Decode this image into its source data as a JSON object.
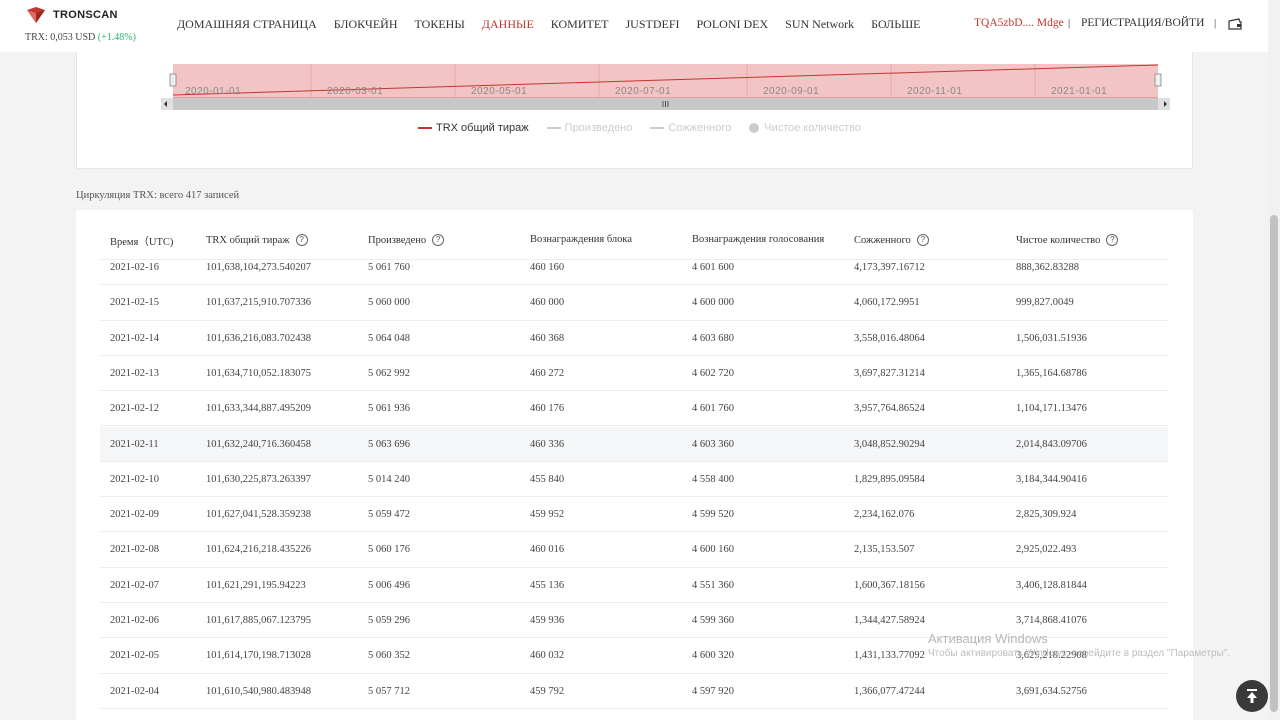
{
  "header": {
    "brand": "TRONSCAN",
    "price_label": "TRX: 0,053 USD",
    "price_change": "(+1.48%)",
    "nav": [
      {
        "label": "ДОМАШНЯЯ СТРАНИЦА",
        "active": false
      },
      {
        "label": "БЛОКЧЕЙН",
        "active": false
      },
      {
        "label": "ТОКЕНЫ",
        "active": false
      },
      {
        "label": "ДАННЫЕ",
        "active": true
      },
      {
        "label": "КОМИТЕТ",
        "active": false
      },
      {
        "label": "JUSTDEFI",
        "active": false
      },
      {
        "label": "POLONI DEX",
        "active": false
      },
      {
        "label": "SUN Network",
        "active": false
      },
      {
        "label": "БОЛЬШЕ",
        "active": false
      }
    ],
    "account": "TQA5zbD.... Mdge",
    "separator": "|",
    "login": "РЕГИСТРАЦИЯ/ВОЙТИ"
  },
  "zoom": {
    "dates": [
      "2020-01-01",
      "2020-03-01",
      "2020-05-01",
      "2020-07-01",
      "2020-09-01",
      "2020-11-01",
      "2021-01-01"
    ]
  },
  "legend": [
    {
      "label": "TRX общий тираж",
      "color": "#c23631",
      "marker": "line",
      "active": true
    },
    {
      "label": "Произведено",
      "color": "#cccccc",
      "marker": "line",
      "active": false
    },
    {
      "label": "Сожженного",
      "color": "#cccccc",
      "marker": "line",
      "active": false
    },
    {
      "label": "Чистое количество",
      "color": "#cccccc",
      "marker": "dot",
      "active": false
    }
  ],
  "table": {
    "caption": "Циркуляция TRX: всего 417 записей",
    "headers": [
      {
        "label": "Время（UTC)",
        "help": false
      },
      {
        "label": "TRX общий тираж",
        "help": true
      },
      {
        "label": "Произведено",
        "help": true
      },
      {
        "label": "Вознаграждения блока",
        "help": false
      },
      {
        "label": "Вознаграждения голосования",
        "help": false
      },
      {
        "label": "Сожженного",
        "help": true
      },
      {
        "label": "Чистое количество",
        "help": true
      }
    ],
    "rows": [
      [
        "2021-02-16",
        "101,638,104,273.540207",
        "5 061 760",
        "460 160",
        "4 601 600",
        "4,173,397.16712",
        "888,362.83288"
      ],
      [
        "2021-02-15",
        "101,637,215,910.707336",
        "5 060 000",
        "460 000",
        "4 600 000",
        "4,060,172.9951",
        "999,827.0049"
      ],
      [
        "2021-02-14",
        "101,636,216,083.702438",
        "5 064 048",
        "460 368",
        "4 603 680",
        "3,558,016.48064",
        "1,506,031.51936"
      ],
      [
        "2021-02-13",
        "101,634,710,052.183075",
        "5 062 992",
        "460 272",
        "4 602 720",
        "3,697,827.31214",
        "1,365,164.68786"
      ],
      [
        "2021-02-12",
        "101,633,344,887.495209",
        "5 061 936",
        "460 176",
        "4 601 760",
        "3,957,764.86524",
        "1,104,171.13476"
      ],
      [
        "2021-02-11",
        "101,632,240,716.360458",
        "5 063 696",
        "460 336",
        "4 603 360",
        "3,048,852.90294",
        "2,014,843.09706"
      ],
      [
        "2021-02-10",
        "101,630,225,873.263397",
        "5 014 240",
        "455 840",
        "4 558 400",
        "1,829,895.09584",
        "3,184,344.90416"
      ],
      [
        "2021-02-09",
        "101,627,041,528.359238",
        "5 059 472",
        "459 952",
        "4 599 520",
        "2,234,162.076",
        "2,825,309.924"
      ],
      [
        "2021-02-08",
        "101,624,216,218.435226",
        "5 060 176",
        "460 016",
        "4 600 160",
        "2,135,153.507",
        "2,925,022.493"
      ],
      [
        "2021-02-07",
        "101,621,291,195.94223",
        "5 006 496",
        "455 136",
        "4 551 360",
        "1,600,367.18156",
        "3,406,128.81844"
      ],
      [
        "2021-02-06",
        "101,617,885,067.123795",
        "5 059 296",
        "459 936",
        "4 599 360",
        "1,344,427.58924",
        "3,714,868.41076"
      ],
      [
        "2021-02-05",
        "101,614,170,198.713028",
        "5 060 352",
        "460 032",
        "4 600 320",
        "1,431,133.77092",
        "3,629,218.22908"
      ],
      [
        "2021-02-04",
        "101,610,540,980.483948",
        "5 057 712",
        "459 792",
        "4 597 920",
        "1,366,077.47244",
        "3,691,634.52756"
      ]
    ]
  },
  "watermark": {
    "title": "Активация Windows",
    "subtitle": "Чтобы активировать Windows, перейдите в раздел \"Параметры\"."
  }
}
